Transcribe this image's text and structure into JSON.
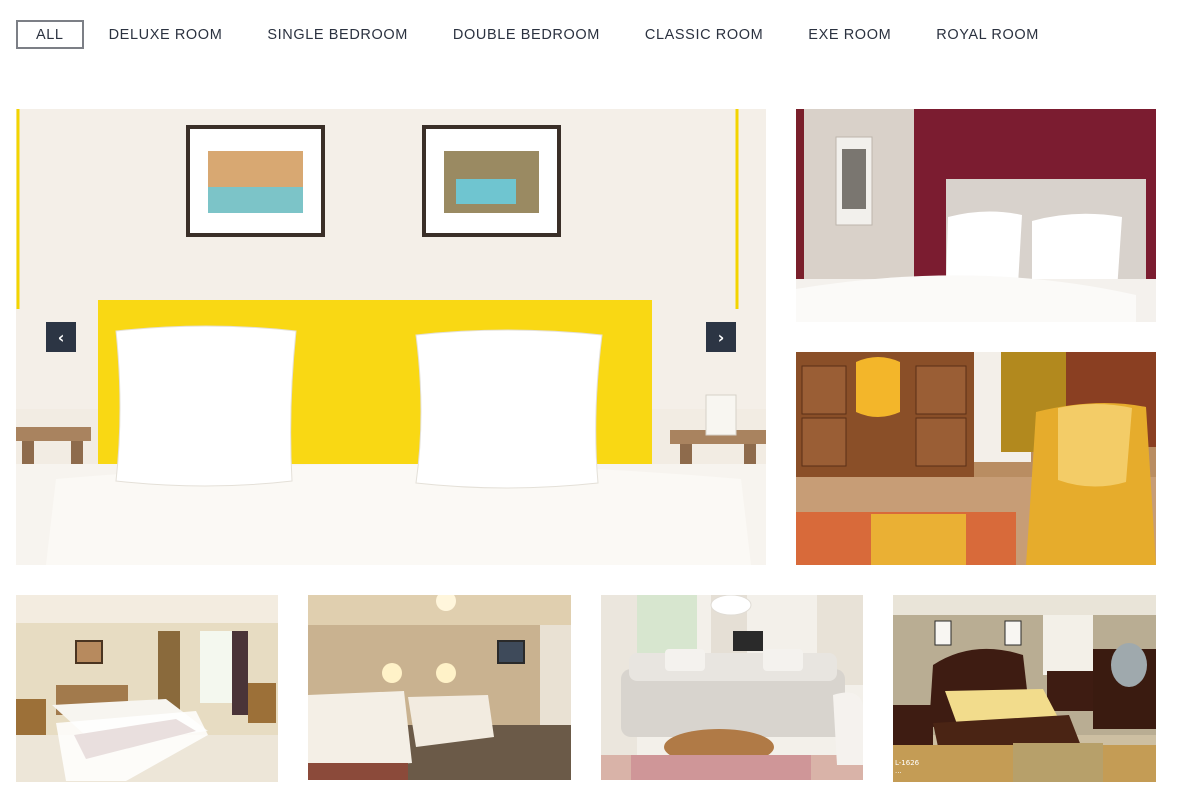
{
  "filters": [
    {
      "label": "ALL",
      "active": true
    },
    {
      "label": "DELUXE ROOM",
      "active": false
    },
    {
      "label": "SINGLE BEDROOM",
      "active": false
    },
    {
      "label": "DOUBLE BEDROOM",
      "active": false
    },
    {
      "label": "CLASSIC ROOM",
      "active": false
    },
    {
      "label": "EXE ROOM",
      "active": false
    },
    {
      "label": "ROYAL ROOM",
      "active": false
    }
  ],
  "slider": {
    "prev_icon": "chevron-left-icon",
    "next_icon": "chevron-right-icon",
    "prev_glyph": "‹",
    "next_glyph": "›"
  },
  "gallery": {
    "photos": [
      {
        "name": "main-photo-yellow-headboard-bedroom"
      },
      {
        "name": "photo-burgundy-wall-bedroom"
      },
      {
        "name": "photo-desk-yellow-chair"
      },
      {
        "name": "photo-bedroom-window"
      },
      {
        "name": "photo-twin-bedroom"
      },
      {
        "name": "photo-living-room-sofa"
      },
      {
        "name": "photo-royal-bedroom"
      }
    ],
    "royal_caption_lines": [
      "L-1626",
      "..."
    ]
  },
  "colors": {
    "accent_dark": "#2c3544",
    "filter_border": "#7c7f86",
    "text": "#2b3240"
  }
}
